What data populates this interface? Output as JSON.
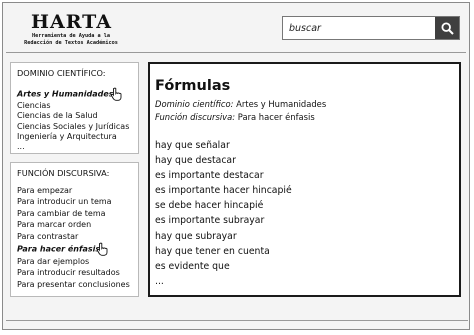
{
  "header": {
    "logo_title": "HARTA",
    "logo_subtitle_1": "Herramienta de Ayuda a la",
    "logo_subtitle_2": "Redacción de Textos Académicos",
    "search_placeholder": "buscar",
    "search_icon": "magnifier-icon"
  },
  "dominio": {
    "title": "DOMINIO CIENTÍFICO:",
    "items": [
      {
        "label": "Artes y Humanidades",
        "active": true
      },
      {
        "label": "Ciencias",
        "active": false
      },
      {
        "label": "Ciencias de la Salud",
        "active": false
      },
      {
        "label": "Ciencias Sociales y Jurídicas",
        "active": false
      },
      {
        "label": "Ingeniería y Arquitectura",
        "active": false
      },
      {
        "label": "...",
        "active": false
      }
    ]
  },
  "funcion": {
    "title": "FUNCIÓN DISCURSIVA:",
    "items": [
      {
        "label": "Para empezar",
        "active": false
      },
      {
        "label": "Para introducir un tema",
        "active": false
      },
      {
        "label": "Para cambiar de tema",
        "active": false
      },
      {
        "label": "Para marcar orden",
        "active": false
      },
      {
        "label": "Para contrastar",
        "active": false
      },
      {
        "label": "Para hacer énfasis",
        "active": true
      },
      {
        "label": "Para dar ejemplos",
        "active": false
      },
      {
        "label": "Para introducir resultados",
        "active": false
      },
      {
        "label": "Para presentar conclusiones",
        "active": false
      }
    ]
  },
  "main": {
    "title": "Fórmulas",
    "meta_dominio_key": "Dominio científico:",
    "meta_dominio_val": "Artes y Humanidades",
    "meta_funcion_key": "Función discursiva:",
    "meta_funcion_val": "Para hacer énfasis",
    "phrases": [
      "hay que señalar",
      "hay que destacar",
      "es importante destacar",
      "es importante hacer hincapié",
      "se debe hacer hincapié",
      "es importante subrayar",
      "hay que subrayar",
      "hay que tener en cuenta",
      "es evidente que",
      "..."
    ]
  }
}
